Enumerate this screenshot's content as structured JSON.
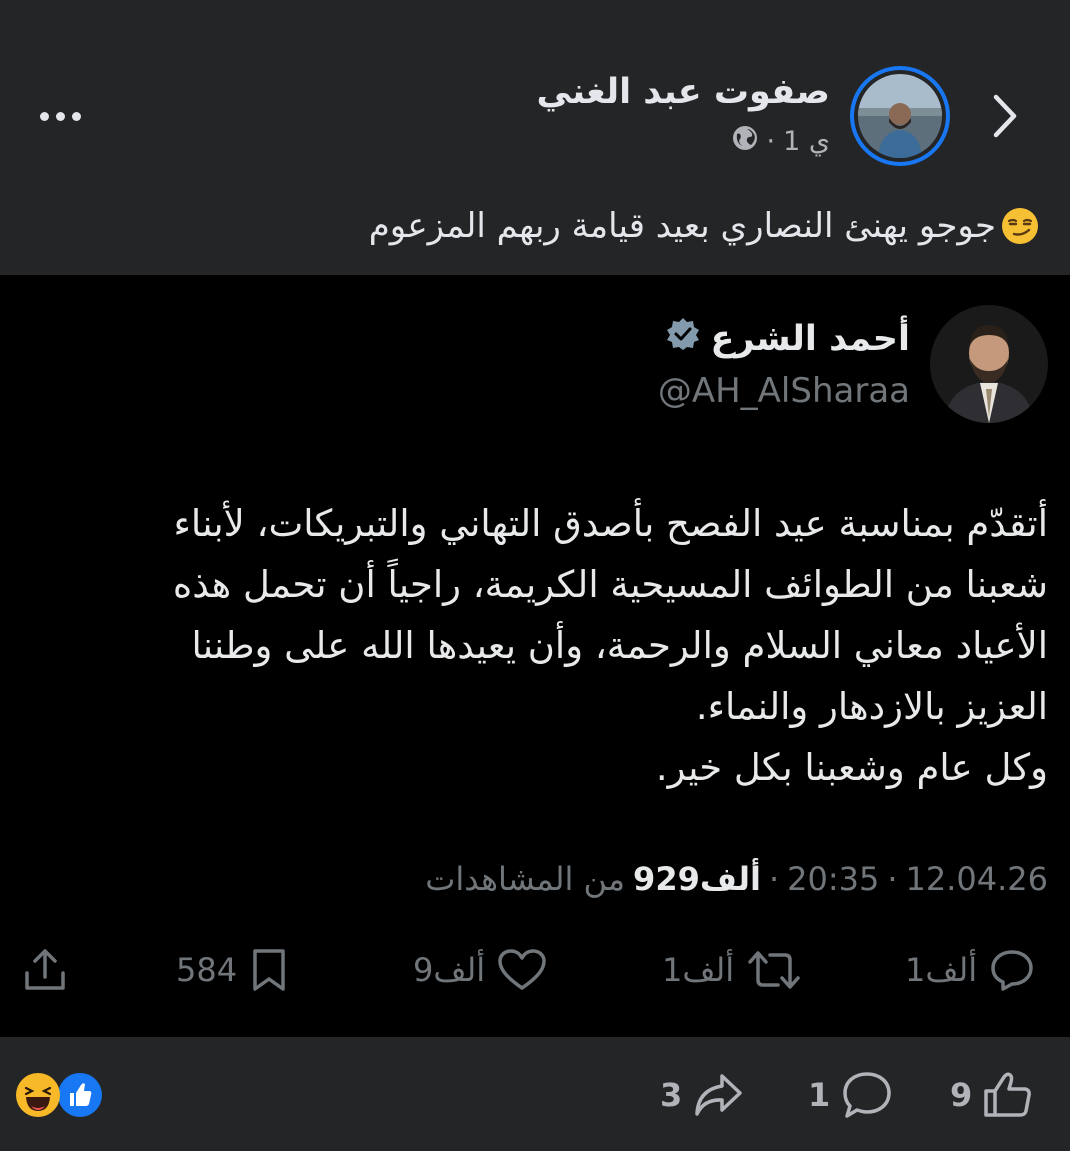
{
  "post": {
    "author_name": "صفوت عبد الغني",
    "time": "1 ي",
    "separator": "·",
    "caption": "جوجو يهنئ النصاري بعيد قيامة ربهم المزعوم"
  },
  "tweet": {
    "name": "أحمد الشرع",
    "handle": "@AH_AlSharaa",
    "body_lines": [
      "أتقدّم بمناسبة عيد الفصح بأصدق التهاني والتبريكات، لأبناء",
      "شعبنا من الطوائف المسيحية الكريمة، راجياً أن تحمل هذه",
      "الأعياد معاني السلام والرحمة، وأن يعيدها الله على وطننا",
      "العزيز بالازدهار والنماء.",
      "وكل عام وشعبنا بكل خير."
    ],
    "date": "12.04.26",
    "time": "20:35",
    "dot": "·",
    "views_count": "929ألف",
    "views_label": "من المشاهدات",
    "replies": "1ألف",
    "retweets": "1ألف",
    "likes": "9ألف",
    "bookmarks": "584"
  },
  "footer": {
    "likes": "9",
    "comments": "1",
    "shares": "3"
  },
  "colors": {
    "page_bg": "#242526",
    "tweet_bg": "#000000",
    "accent": "#1877f2",
    "muted": "#b0b3b8",
    "tweet_muted": "#71767b"
  },
  "icons": [
    "chevron-right-icon",
    "globe-icon",
    "more-icon",
    "verified-badge-icon",
    "reply-icon",
    "retweet-icon",
    "like-icon",
    "bookmark-icon",
    "share-icon",
    "thumbs-up-icon",
    "comment-icon",
    "share-arrow-icon"
  ]
}
